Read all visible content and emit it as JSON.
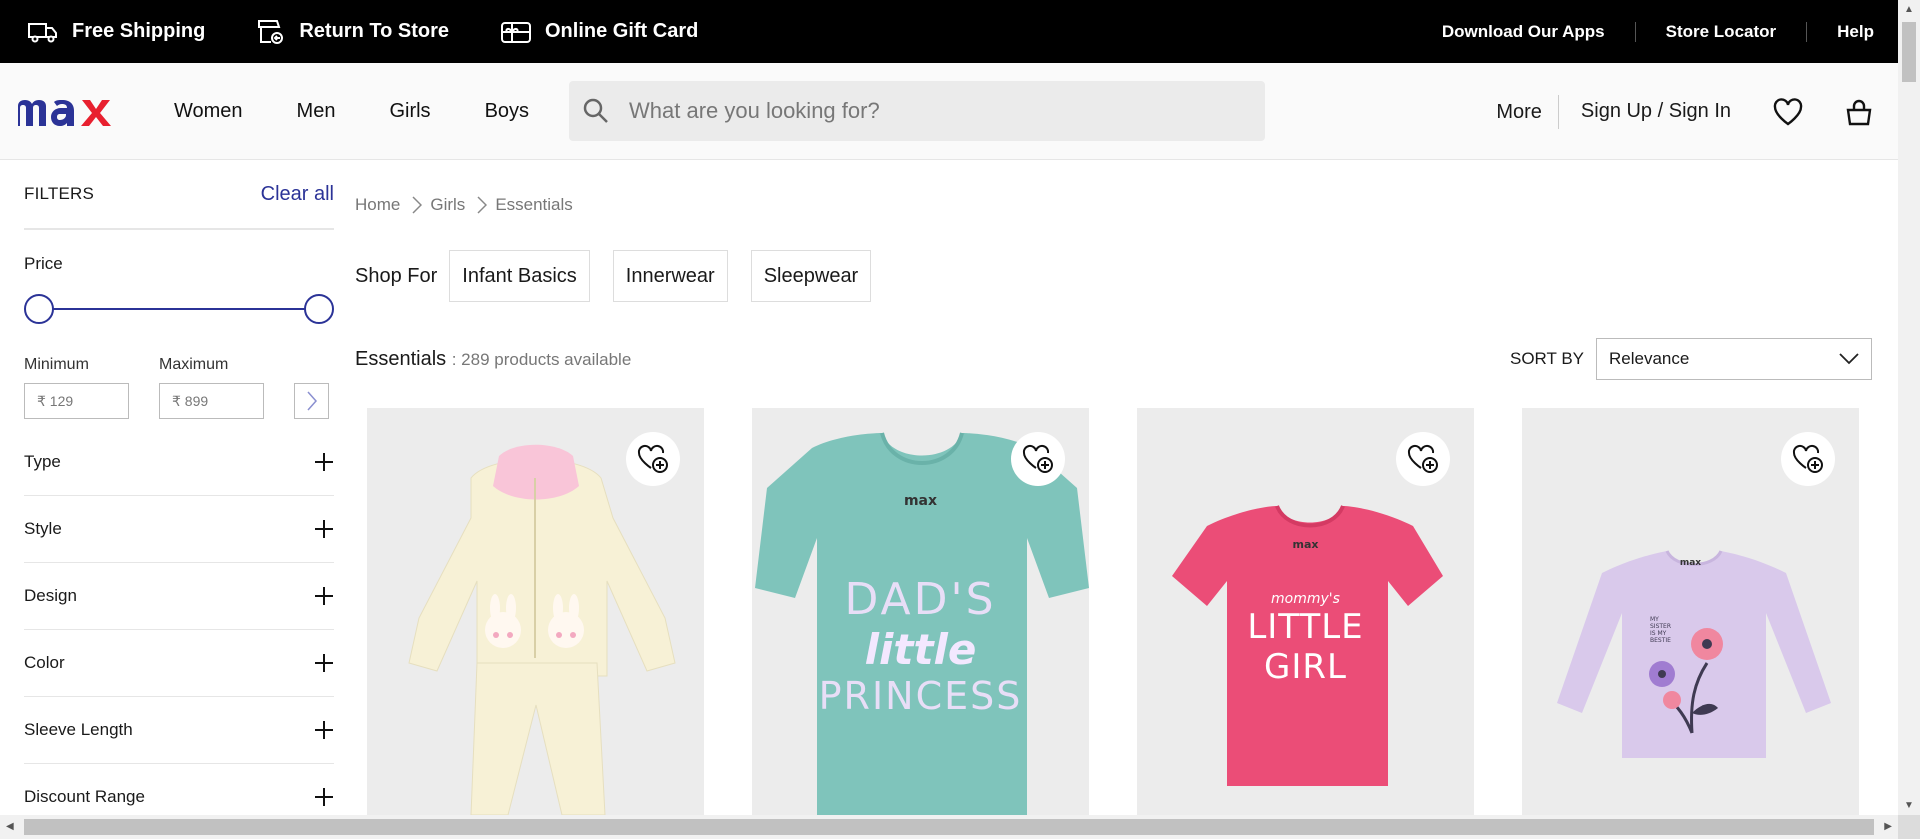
{
  "topbar": {
    "left": [
      {
        "label": "Free Shipping",
        "icon": "truck-icon"
      },
      {
        "label": "Return To Store",
        "icon": "store-return-icon"
      },
      {
        "label": "Online Gift Card",
        "icon": "gift-card-icon"
      }
    ],
    "right": [
      "Download Our Apps",
      "Store Locator",
      "Help"
    ]
  },
  "header": {
    "logo": "max",
    "nav": [
      "Women",
      "Men",
      "Girls",
      "Boys"
    ],
    "search_placeholder": "What are you looking for?",
    "more": "More",
    "signin": "Sign Up / Sign In"
  },
  "filters": {
    "title": "FILTERS",
    "clear": "Clear all",
    "price_title": "Price",
    "min_label": "Minimum",
    "max_label": "Maximum",
    "min_value": "₹ 129",
    "max_value": "₹ 899",
    "facets": [
      "Type",
      "Style",
      "Design",
      "Color",
      "Sleeve Length",
      "Discount Range"
    ]
  },
  "breadcrumb": [
    "Home",
    "Girls",
    "Essentials"
  ],
  "shop_for": {
    "label": "Shop For",
    "chips": [
      "Infant Basics",
      "Innerwear",
      "Sleepwear"
    ]
  },
  "results": {
    "category": "Essentials",
    "count_text": ": 289 products available"
  },
  "sort": {
    "label": "SORT BY",
    "value": "Relevance"
  },
  "products": [
    {
      "graphic": "hoodie-set",
      "color": "#f7f1d6"
    },
    {
      "graphic": "tshirt-print",
      "print": [
        "DAD'S",
        "little",
        "PRINCESS"
      ],
      "tag": "max",
      "color": "#7fc4bb"
    },
    {
      "graphic": "tshirt-print",
      "print": [
        "mommy's",
        "LITTLE",
        "GIRL"
      ],
      "tag": "max",
      "color": "#eb4d77"
    },
    {
      "graphic": "longsleeve-flower",
      "print": [
        "MY",
        "SISTER",
        "IS MY",
        "BESTIE"
      ],
      "tag": "max",
      "color": "#d9c9eb"
    }
  ],
  "colors": {
    "brand_blue": "#2b3397",
    "brand_red": "#e8202f",
    "topbar_bg": "#000000"
  }
}
